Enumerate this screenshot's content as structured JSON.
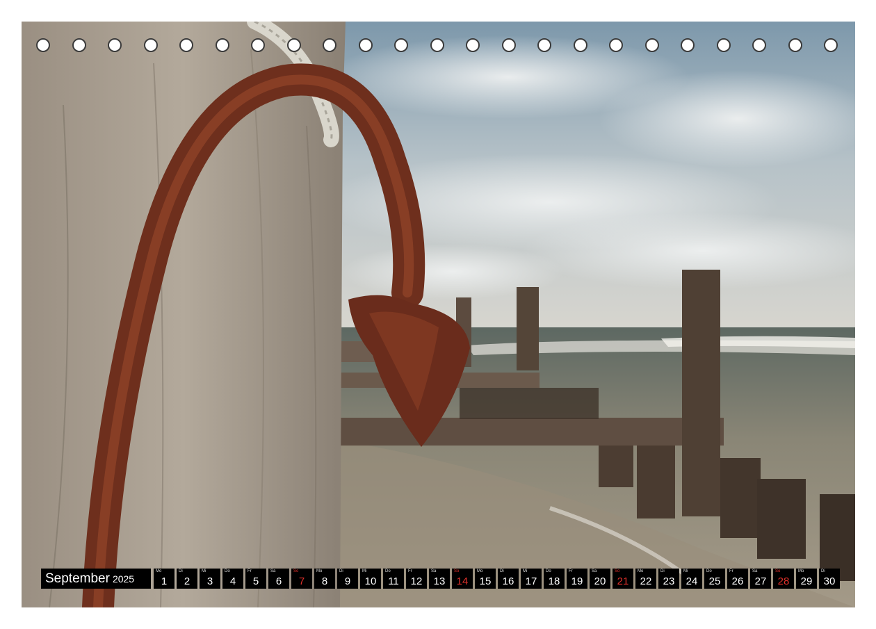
{
  "calendar": {
    "month": "September",
    "year": "2025",
    "days": [
      {
        "wd": "Mo",
        "n": "1"
      },
      {
        "wd": "Di",
        "n": "2"
      },
      {
        "wd": "Mi",
        "n": "3"
      },
      {
        "wd": "Do",
        "n": "4"
      },
      {
        "wd": "Fr",
        "n": "5"
      },
      {
        "wd": "Sa",
        "n": "6"
      },
      {
        "wd": "So",
        "n": "7",
        "sunday": true
      },
      {
        "wd": "Mo",
        "n": "8"
      },
      {
        "wd": "Di",
        "n": "9"
      },
      {
        "wd": "Mi",
        "n": "10"
      },
      {
        "wd": "Do",
        "n": "11"
      },
      {
        "wd": "Fr",
        "n": "12"
      },
      {
        "wd": "Sa",
        "n": "13"
      },
      {
        "wd": "So",
        "n": "14",
        "sunday": true
      },
      {
        "wd": "Mo",
        "n": "15"
      },
      {
        "wd": "Di",
        "n": "16"
      },
      {
        "wd": "Mi",
        "n": "17"
      },
      {
        "wd": "Do",
        "n": "18"
      },
      {
        "wd": "Fr",
        "n": "19"
      },
      {
        "wd": "Sa",
        "n": "20"
      },
      {
        "wd": "So",
        "n": "21",
        "sunday": true
      },
      {
        "wd": "Mo",
        "n": "22"
      },
      {
        "wd": "Di",
        "n": "23"
      },
      {
        "wd": "Mi",
        "n": "24"
      },
      {
        "wd": "Do",
        "n": "25"
      },
      {
        "wd": "Fr",
        "n": "26"
      },
      {
        "wd": "Sa",
        "n": "27"
      },
      {
        "wd": "So",
        "n": "28",
        "sunday": true
      },
      {
        "wd": "Mo",
        "n": "29"
      },
      {
        "wd": "Di",
        "n": "30"
      }
    ]
  },
  "binding_holes": 23,
  "colors": {
    "sunday": "#e0302a",
    "bar": "#000000",
    "rust": "#7a3320",
    "sky": "#8fa6b6",
    "sea": "#6e6a5c"
  }
}
